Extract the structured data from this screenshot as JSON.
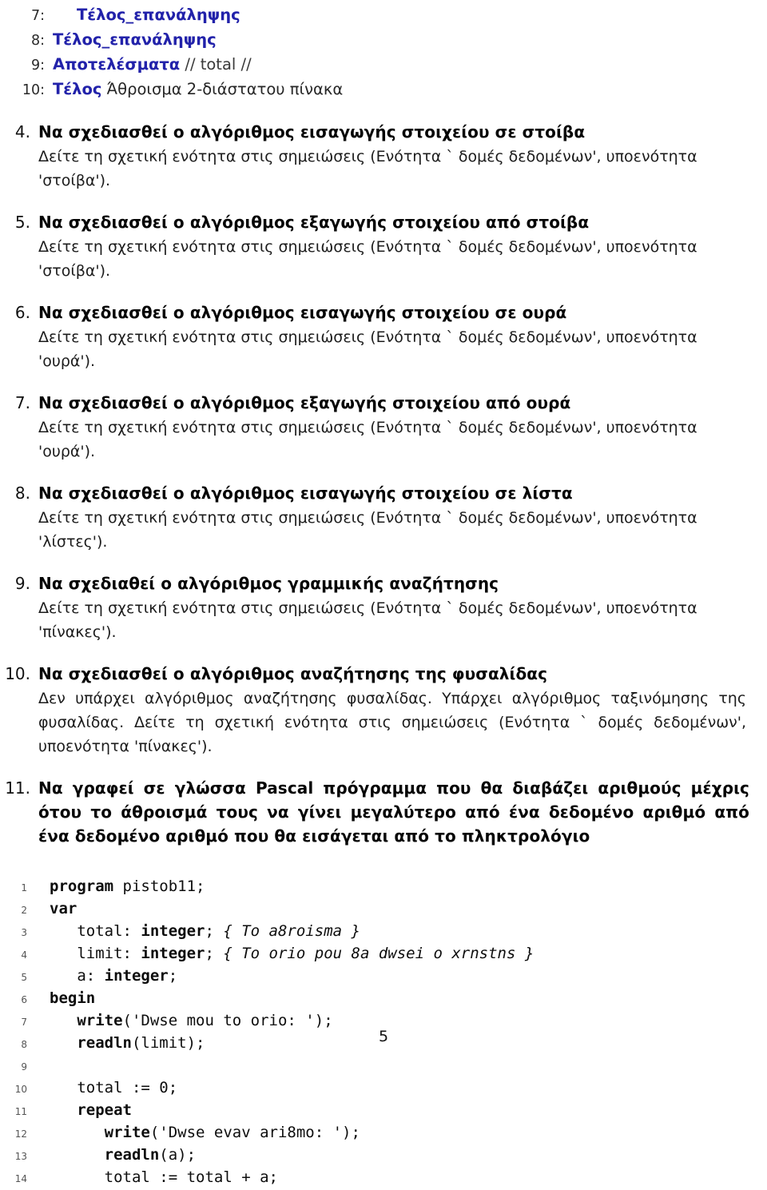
{
  "document": {
    "page_number": "5",
    "accent_color": "#2222aa"
  },
  "pseudocode": {
    "lines": [
      {
        "number": "7:",
        "indent": 1,
        "segments": [
          {
            "kind": "keyword",
            "text": "Τέλος_επανάληψης"
          }
        ]
      },
      {
        "number": "8:",
        "indent": 0,
        "segments": [
          {
            "kind": "keyword",
            "text": "Τέλος_επανάληψης"
          }
        ]
      },
      {
        "number": "9:",
        "indent": 0,
        "segments": [
          {
            "kind": "keyword",
            "text": "Αποτελέσματα"
          },
          {
            "kind": "comment",
            "text": " // total //"
          }
        ]
      },
      {
        "number": "10:",
        "indent": 0,
        "segments": [
          {
            "kind": "keyword",
            "text": "Τέλος"
          },
          {
            "kind": "plain",
            "text": " Άθροισμα 2-διάστατου πίνακα"
          }
        ]
      }
    ]
  },
  "exercises": [
    {
      "number": "4.",
      "title": "Να σχεδιασθεί ο αλγόριθμος εισαγωγής στοιχείου σε στοίβα",
      "body": "Δείτε τη σχετική ενότητα στις σημειώσεις (Ενότητα ` δομές δεδομένων', υποενότητα 'στοίβα')."
    },
    {
      "number": "5.",
      "title": "Να σχεδιασθεί ο αλγόριθμος εξαγωγής στοιχείου από στοίβα",
      "body": "Δείτε τη σχετική ενότητα στις σημειώσεις (Ενότητα ` δομές δεδομένων', υποενότητα 'στοίβα')."
    },
    {
      "number": "6.",
      "title": "Να σχεδιασθεί ο αλγόριθμος εισαγωγής στοιχείου σε ουρά",
      "body": "Δείτε τη σχετική ενότητα στις σημειώσεις (Ενότητα ` δομές δεδομένων', υποενότητα 'ουρά')."
    },
    {
      "number": "7.",
      "title": "Να σχεδιασθεί ο αλγόριθμος εξαγωγής στοιχείου από ουρά",
      "body": "Δείτε τη σχετική ενότητα στις σημειώσεις (Ενότητα ` δομές δεδομένων', υποενότητα 'ουρά')."
    },
    {
      "number": "8.",
      "title": "Να σχεδιασθεί ο αλγόριθμος εισαγωγής στοιχείου σε λίστα",
      "body": "Δείτε τη σχετική ενότητα στις σημειώσεις (Ενότητα ` δομές δεδομένων', υποενότητα 'λίστες')."
    },
    {
      "number": "9.",
      "title": "Να σχεδιαθεί ο αλγόριθμος γραμμικής αναζήτησης",
      "body": "Δείτε τη σχετική ενότητα στις σημειώσεις (Ενότητα ` δομές δεδομένων', υποενότητα 'πίνακες')."
    },
    {
      "number": "10.",
      "title": "Να σχεδιασθεί ο αλγόριθμος αναζήτησης της φυσαλίδας",
      "body": "Δεν υπάρχει αλγόριθμος αναζήτησης φυσαλίδας. Υπάρχει αλγόριθμος ταξινόμησης της φυσαλίδας. Δείτε τη σχετική ενότητα στις σημειώσεις (Ενότητα ` δομές δεδομένων', υποενότητα 'πίνακες')."
    },
    {
      "number": "11.",
      "title": "Να γραφεί σε γλώσσα Pascal πρόγραμμα που θα διαβάζει αριθμούς μέχρις ότου το άθροισμά τους να γίνει μεγαλύτερο από ένα δεδομένο αριθμό από ένα δεδομένο αριθμό που θα εισάγεται από το πληκτρολόγιο",
      "body": ""
    }
  ],
  "code_listing": {
    "language": "Pascal",
    "lines": [
      {
        "number": "1",
        "code": "program pistob11;"
      },
      {
        "number": "2",
        "code": "var"
      },
      {
        "number": "3",
        "code": "   total: integer; { To a8roisma }"
      },
      {
        "number": "4",
        "code": "   limit: integer; { To orio pou 8a dwsei o xrnstns }"
      },
      {
        "number": "5",
        "code": "   a: integer;"
      },
      {
        "number": "6",
        "code": "begin"
      },
      {
        "number": "7",
        "code": "   write('Dwse mou to orio: ');"
      },
      {
        "number": "8",
        "code": "   readln(limit);"
      },
      {
        "number": "9",
        "code": ""
      },
      {
        "number": "10",
        "code": "   total := 0;"
      },
      {
        "number": "11",
        "code": "   repeat"
      },
      {
        "number": "12",
        "code": "      write('Dwse evav ari8mo: ');"
      },
      {
        "number": "13",
        "code": "      readln(a);"
      },
      {
        "number": "14",
        "code": "      total := total + a;"
      }
    ]
  }
}
